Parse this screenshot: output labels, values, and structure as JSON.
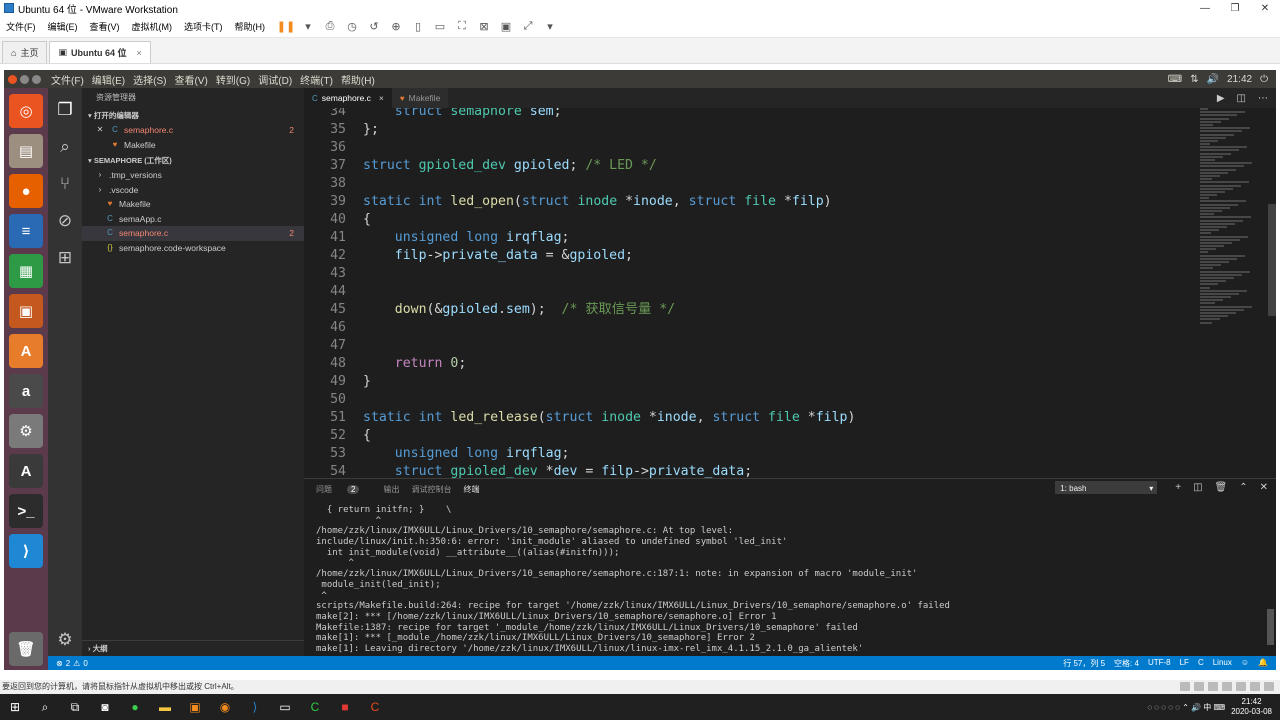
{
  "vmware": {
    "title": "Ubuntu 64 位 - VMware Workstation",
    "menu": [
      "文件(F)",
      "编辑(E)",
      "查看(V)",
      "虚拟机(M)",
      "选项卡(T)",
      "帮助(H)"
    ],
    "tabs": [
      {
        "label": "主页",
        "icon": "home-icon"
      },
      {
        "label": "Ubuntu 64 位",
        "icon": "vm-icon"
      }
    ],
    "hint": "要返回到您的计算机，请将鼠标指针从虚拟机中移出或按 Ctrl+Alt。"
  },
  "ubuntu": {
    "menu": [
      "文件(F)",
      "编辑(E)",
      "选择(S)",
      "查看(V)",
      "转到(G)",
      "调试(D)",
      "终端(T)",
      "帮助(H)"
    ],
    "clock": "21:42"
  },
  "launcher": {
    "apps": [
      {
        "name": "ubuntu-icon",
        "glyph": "◎",
        "color": "#e95420"
      },
      {
        "name": "files-icon",
        "glyph": "▤",
        "color": "#9c8f7f"
      },
      {
        "name": "firefox-icon",
        "glyph": "●",
        "color": "#e66000"
      },
      {
        "name": "writer-icon",
        "glyph": "≡",
        "color": "#2a6ab4"
      },
      {
        "name": "calc-icon",
        "glyph": "▦",
        "color": "#2f9a45"
      },
      {
        "name": "impress-icon",
        "glyph": "▣",
        "color": "#c3591e"
      },
      {
        "name": "software-icon",
        "glyph": "A",
        "color": "#e77d2b"
      },
      {
        "name": "amazon-icon",
        "glyph": "a",
        "color": "#4a4a4a"
      },
      {
        "name": "settings-icon",
        "glyph": "⚙",
        "color": "#7a7a7a"
      },
      {
        "name": "updater-icon",
        "glyph": "A",
        "color": "#3a3a3a"
      },
      {
        "name": "terminal-icon",
        "glyph": ">_",
        "color": "#2c2c2c"
      },
      {
        "name": "vscode-icon",
        "glyph": "⟩",
        "color": "#1e88d4"
      }
    ],
    "trash": {
      "name": "trash-icon",
      "glyph": "🗑",
      "color": "#6a6a6a"
    }
  },
  "explorer": {
    "header": "资源管理器",
    "open_editors_label": "打开的编辑器",
    "open_editors": [
      {
        "label": "semaphore.c",
        "icon": "C",
        "modified": true,
        "badge": "2",
        "close": true
      },
      {
        "label": "Makefile",
        "icon": "♥",
        "modified": false,
        "badge": "",
        "close": false
      }
    ],
    "workspace_label": "SEMAPHORE (工作区)",
    "files": [
      {
        "label": ".tmp_versions",
        "icon": "›",
        "folder": true
      },
      {
        "label": ".vscode",
        "icon": "›",
        "folder": true
      },
      {
        "label": "Makefile",
        "icon": "♥",
        "folder": false
      },
      {
        "label": "semaApp.c",
        "icon": "C",
        "folder": false
      },
      {
        "label": "semaphore.c",
        "icon": "C",
        "folder": false,
        "error": true,
        "badge": "2"
      },
      {
        "label": "semaphore.code-workspace",
        "icon": "{}",
        "folder": false
      }
    ],
    "outline_label": "大纲"
  },
  "editor_tabs": [
    {
      "label": "semaphore.c",
      "icon": "C",
      "active": true,
      "close": "×"
    },
    {
      "label": "Makefile",
      "icon": "♥",
      "active": false,
      "close": ""
    }
  ],
  "code": [
    {
      "no": "34",
      "html": "    <span class='k'>struct</span> <span class='t'>semaphore</span> <span class='v'>sem</span>;"
    },
    {
      "no": "35",
      "html": "};"
    },
    {
      "no": "36",
      "html": ""
    },
    {
      "no": "37",
      "html": "<span class='k'>struct</span> <span class='t'>gpioled_dev</span> <span class='v'>gpioled</span>; <span class='c'>/* LED */</span>"
    },
    {
      "no": "38",
      "html": ""
    },
    {
      "no": "39",
      "html": "<span class='k'>static</span> <span class='k'>int</span> <span class='f'>led_open</span>(<span class='k'>struct</span> <span class='t'>inode</span> *<span class='v'>inode</span>, <span class='k'>struct</span> <span class='t'>file</span> *<span class='v'>filp</span>)"
    },
    {
      "no": "40",
      "html": "{"
    },
    {
      "no": "41",
      "html": "    <span class='k'>unsigned</span> <span class='k'>long</span> <span class='v'>irqflag</span>;"
    },
    {
      "no": "42",
      "html": "    <span class='v'>filp</span>-><span class='v'>private_data</span> = &amp;<span class='v'>gpioled</span>;"
    },
    {
      "no": "43",
      "html": ""
    },
    {
      "no": "44",
      "html": ""
    },
    {
      "no": "45",
      "html": "    <span class='f'>down</span>(&amp;<span class='v'>gpioled</span>.<span class='v'>sem</span>);  <span class='c'>/* 获取信号量 */</span>"
    },
    {
      "no": "46",
      "html": ""
    },
    {
      "no": "47",
      "html": ""
    },
    {
      "no": "48",
      "html": "    <span class='r'>return</span> <span class='n'>0</span>;"
    },
    {
      "no": "49",
      "html": "}"
    },
    {
      "no": "50",
      "html": ""
    },
    {
      "no": "51",
      "html": "<span class='k'>static</span> <span class='k'>int</span> <span class='f'>led_release</span>(<span class='k'>struct</span> <span class='t'>inode</span> *<span class='v'>inode</span>, <span class='k'>struct</span> <span class='t'>file</span> *<span class='v'>filp</span>)"
    },
    {
      "no": "52",
      "html": "{"
    },
    {
      "no": "53",
      "html": "    <span class='k'>unsigned</span> <span class='k'>long</span> <span class='v'>irqflag</span>;"
    },
    {
      "no": "54",
      "html": "    <span class='k'>struct</span> <span class='t'>gpioled_dev</span> *<span class='v'>dev</span> = <span class='v'>filp</span>-><span class='v'>private_data</span>;"
    }
  ],
  "panel": {
    "tabs": [
      {
        "label": "问题",
        "count": "2",
        "active": false
      },
      {
        "label": "输出",
        "count": "",
        "active": false
      },
      {
        "label": "调试控制台",
        "count": "",
        "active": false
      },
      {
        "label": "终端",
        "count": "",
        "active": true
      }
    ],
    "terminal_select": "1: bash",
    "terminal_lines": [
      "  { return initfn; }    \\",
      "           ^",
      "/home/zzk/linux/IMX6ULL/Linux_Drivers/10_semaphore/semaphore.c: At top level:",
      "include/linux/init.h:350:6: error: 'init_module' aliased to undefined symbol 'led_init'",
      "  int init_module(void) __attribute__((alias(#initfn)));",
      "      ^",
      "/home/zzk/linux/IMX6ULL/Linux_Drivers/10_semaphore/semaphore.c:187:1: note: in expansion of macro 'module_init'",
      " module_init(led_init);",
      " ^",
      "scripts/Makefile.build:264: recipe for target '/home/zzk/linux/IMX6ULL/Linux_Drivers/10_semaphore/semaphore.o' failed",
      "make[2]: *** [/home/zzk/linux/IMX6ULL/Linux_Drivers/10_semaphore/semaphore.o] Error 1",
      "Makefile:1387: recipe for target '_module_/home/zzk/linux/IMX6ULL/Linux_Drivers/10_semaphore' failed",
      "make[1]: *** [_module_/home/zzk/linux/IMX6ULL/Linux_Drivers/10_semaphore] Error 2",
      "make[1]: Leaving directory '/home/zzk/linux/IMX6ULL/linux/linux-imx-rel_imx_4.1.15_2.1.0_ga_alientek'"
    ]
  },
  "status": {
    "errors": "2",
    "warnings": "0",
    "position": "行 57，列 5",
    "spaces": "空格: 4",
    "encoding": "UTF-8",
    "eol": "LF",
    "language": "C",
    "platform": "Linux"
  },
  "taskbar": {
    "time": "21:42",
    "date": "2020-03-08"
  }
}
